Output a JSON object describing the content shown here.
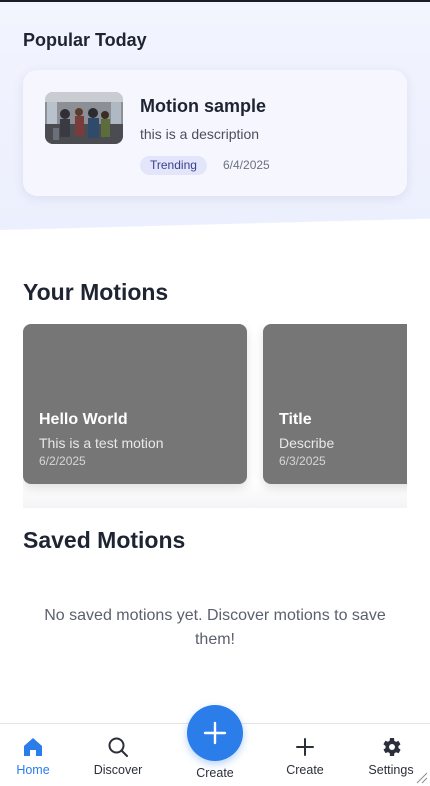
{
  "popular": {
    "section_title": "Popular Today",
    "card": {
      "title": "Motion sample",
      "description": "this is a description",
      "badge": "Trending",
      "date": "6/4/2025"
    }
  },
  "your_motions": {
    "section_title": "Your Motions",
    "items": [
      {
        "title": "Hello World",
        "description": "This is a test motion",
        "date": "6/2/2025"
      },
      {
        "title": "Title",
        "description": "Describe",
        "date": "6/3/2025"
      }
    ]
  },
  "saved_motions": {
    "section_title": "Saved Motions",
    "empty_message": "No saved motions yet. Discover motions to save them!"
  },
  "bottom_nav": {
    "items": [
      {
        "label": "Home",
        "icon": "home-icon",
        "active": true
      },
      {
        "label": "Discover",
        "icon": "search-icon",
        "active": false
      },
      {
        "label": "Create",
        "icon": "plus-icon",
        "active": false,
        "fab": true
      },
      {
        "label": "Create",
        "icon": "plus-icon",
        "active": false
      },
      {
        "label": "Settings",
        "icon": "gear-icon",
        "active": false
      }
    ]
  },
  "colors": {
    "accent": "#2b7de9",
    "card_gray": "#767676",
    "badge_bg": "#e3e5fb",
    "text_dark": "#1f2433"
  }
}
